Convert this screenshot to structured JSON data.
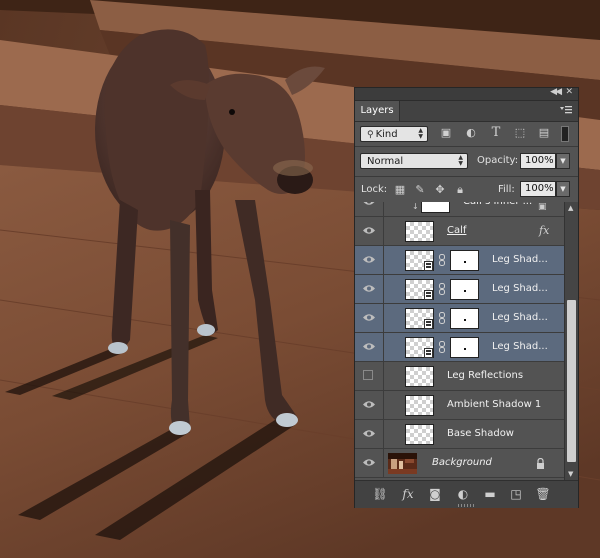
{
  "panel": {
    "tab_label": "Layers",
    "filter": {
      "value": "Kind",
      "icons": [
        "pixel-filter-icon",
        "adjustment-filter-icon",
        "type-filter-icon",
        "shape-filter-icon",
        "smart-object-filter-icon"
      ]
    },
    "blend_mode": "Normal",
    "opacity_label": "Opacity:",
    "opacity_value": "100%",
    "lock_label": "Lock:",
    "fill_label": "Fill:",
    "fill_value": "100%"
  },
  "layers": [
    {
      "name": "Calf's Inner ...",
      "visible": true,
      "selected": false
    },
    {
      "name": "Calf",
      "visible": true,
      "selected": false,
      "fx": "fx"
    },
    {
      "name": "Leg Shad...",
      "visible": true,
      "selected": true
    },
    {
      "name": "Leg Shad...",
      "visible": true,
      "selected": true
    },
    {
      "name": "Leg Shad...",
      "visible": true,
      "selected": true
    },
    {
      "name": "Leg Shad...",
      "visible": true,
      "selected": true
    },
    {
      "name": "Leg Reflections",
      "visible": false,
      "selected": false
    },
    {
      "name": "Ambient Shadow 1",
      "visible": true,
      "selected": false
    },
    {
      "name": "Base Shadow",
      "visible": true,
      "selected": false
    },
    {
      "name": "Background",
      "visible": true,
      "selected": false,
      "locked": true
    }
  ],
  "bottom_toolbar": [
    "link-layers-icon",
    "fx-icon",
    "add-mask-icon",
    "adjustment-layer-icon",
    "new-group-icon",
    "new-layer-icon",
    "delete-layer-icon"
  ],
  "colors": {
    "panel_bg": "#535353",
    "selected_row": "#5c6a7e",
    "floor": "#7a4a32"
  }
}
